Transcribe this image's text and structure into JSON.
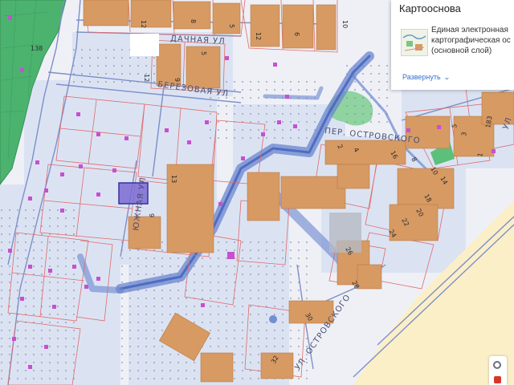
{
  "map": {
    "streets": {
      "dachnaya": "ДАЧНАЯ УЛ",
      "berezovaya": "БЕРЕЗОВАЯ УЛ",
      "ostrovskogo_lane": "ПЕР. ОСТРОВСКОГО",
      "yuzhnaya": "ЮЖНАЯ УЛ",
      "ostrovskogo_street": "УЛ. ОСТРОВСКОГО",
      "corner": "УЛ"
    },
    "parcel_numbers": [
      "138",
      "12",
      "8",
      "5",
      "12",
      "6",
      "10",
      "12",
      "9",
      "5",
      "13",
      "9",
      "2",
      "4",
      "16",
      "8",
      "10",
      "14",
      "18",
      "20",
      "22",
      "24",
      "26",
      "28",
      "30",
      "32",
      "183",
      "1",
      "3",
      "5"
    ],
    "colors": {
      "background": "#eef0f6",
      "building": "#d79a63",
      "forest": "#4bb36e",
      "parcel_line": "#e06a6a",
      "road_highlight": "#5a79c9",
      "structure": "#c84fd0",
      "sea": "#fbefc8"
    }
  },
  "panel": {
    "title": "Картооснова",
    "layer_desc_line1": "Единая электронная",
    "layer_desc_line2": "картографическая ос",
    "layer_desc_line3": "(основной слой)",
    "expand_label": "Развернуть",
    "thumb_icon": "map-thumbnail-icon"
  }
}
